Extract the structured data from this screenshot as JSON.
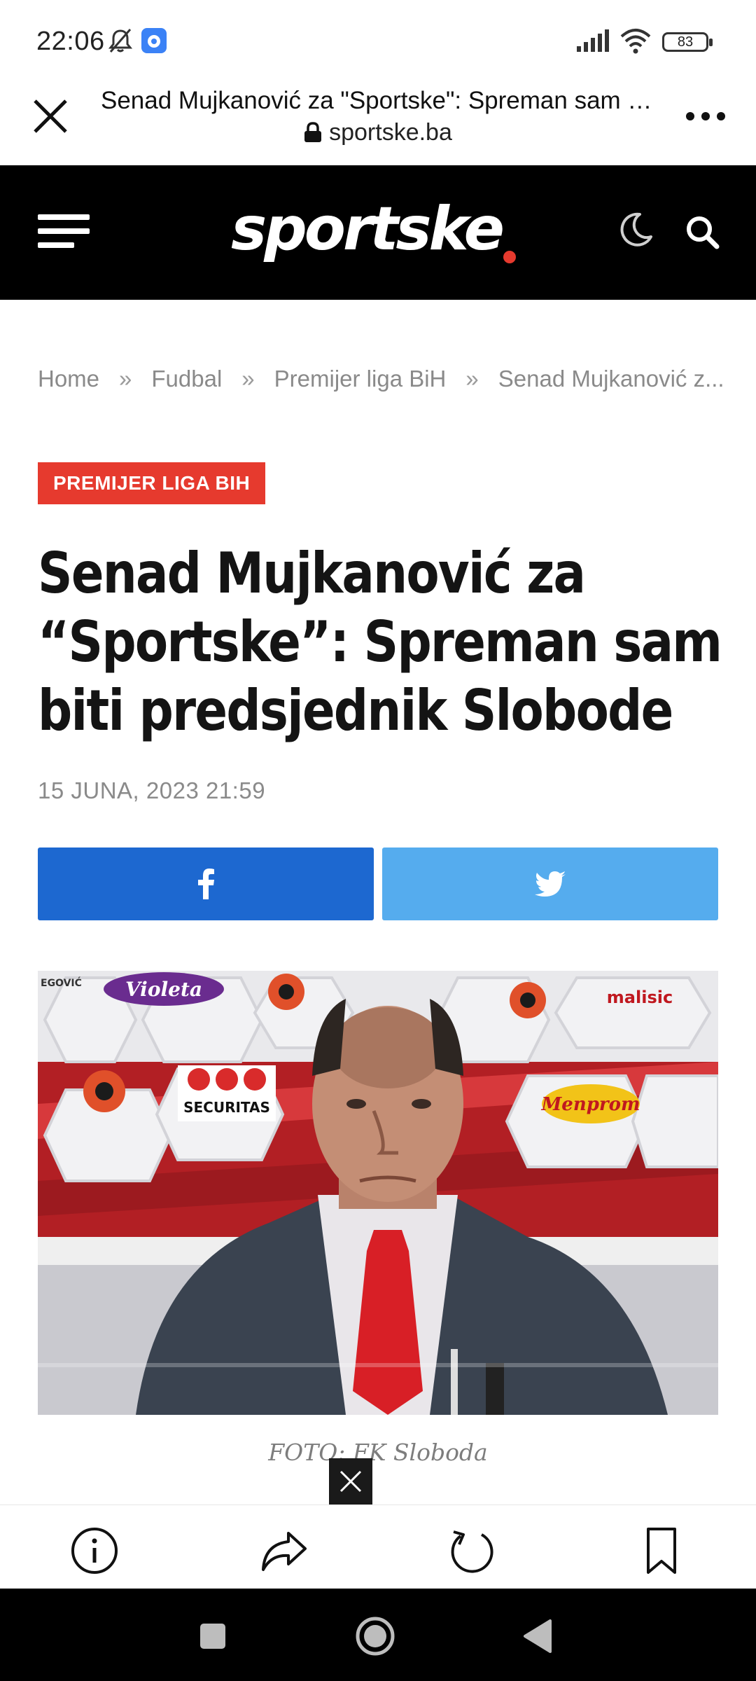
{
  "status_bar": {
    "time": "22:06",
    "battery": "83",
    "icons": [
      "bell-off-icon",
      "app-notification-icon",
      "signal-icon",
      "wifi-icon",
      "battery-icon"
    ]
  },
  "browser": {
    "page_title": "Senad Mujkanović za \"Sportske\": Spreman sam biti predsjednik Slobode",
    "url": "sportske.ba"
  },
  "site": {
    "logo_text": "sportske",
    "accent_color": "#e63a2e"
  },
  "breadcrumb": {
    "items": [
      "Home",
      "Fudbal",
      "Premijer liga BiH",
      "Senad Mujkanović z..."
    ],
    "separator": "»"
  },
  "article": {
    "category": "PREMIJER LIGA BIH",
    "headline": "Senad Mujkanović za “Sportske”: Spreman sam biti predsjednik Slobode",
    "date": "15 JUNA, 2023 21:59",
    "photo_caption": "FOTO: FK Sloboda",
    "photo_sponsor_text": [
      "Violeta",
      "SECURITAS",
      "Menprom",
      "malisic",
      "EGOVIĆ"
    ]
  },
  "share": {
    "facebook_color": "#1d68d0",
    "twitter_color": "#55acee"
  }
}
